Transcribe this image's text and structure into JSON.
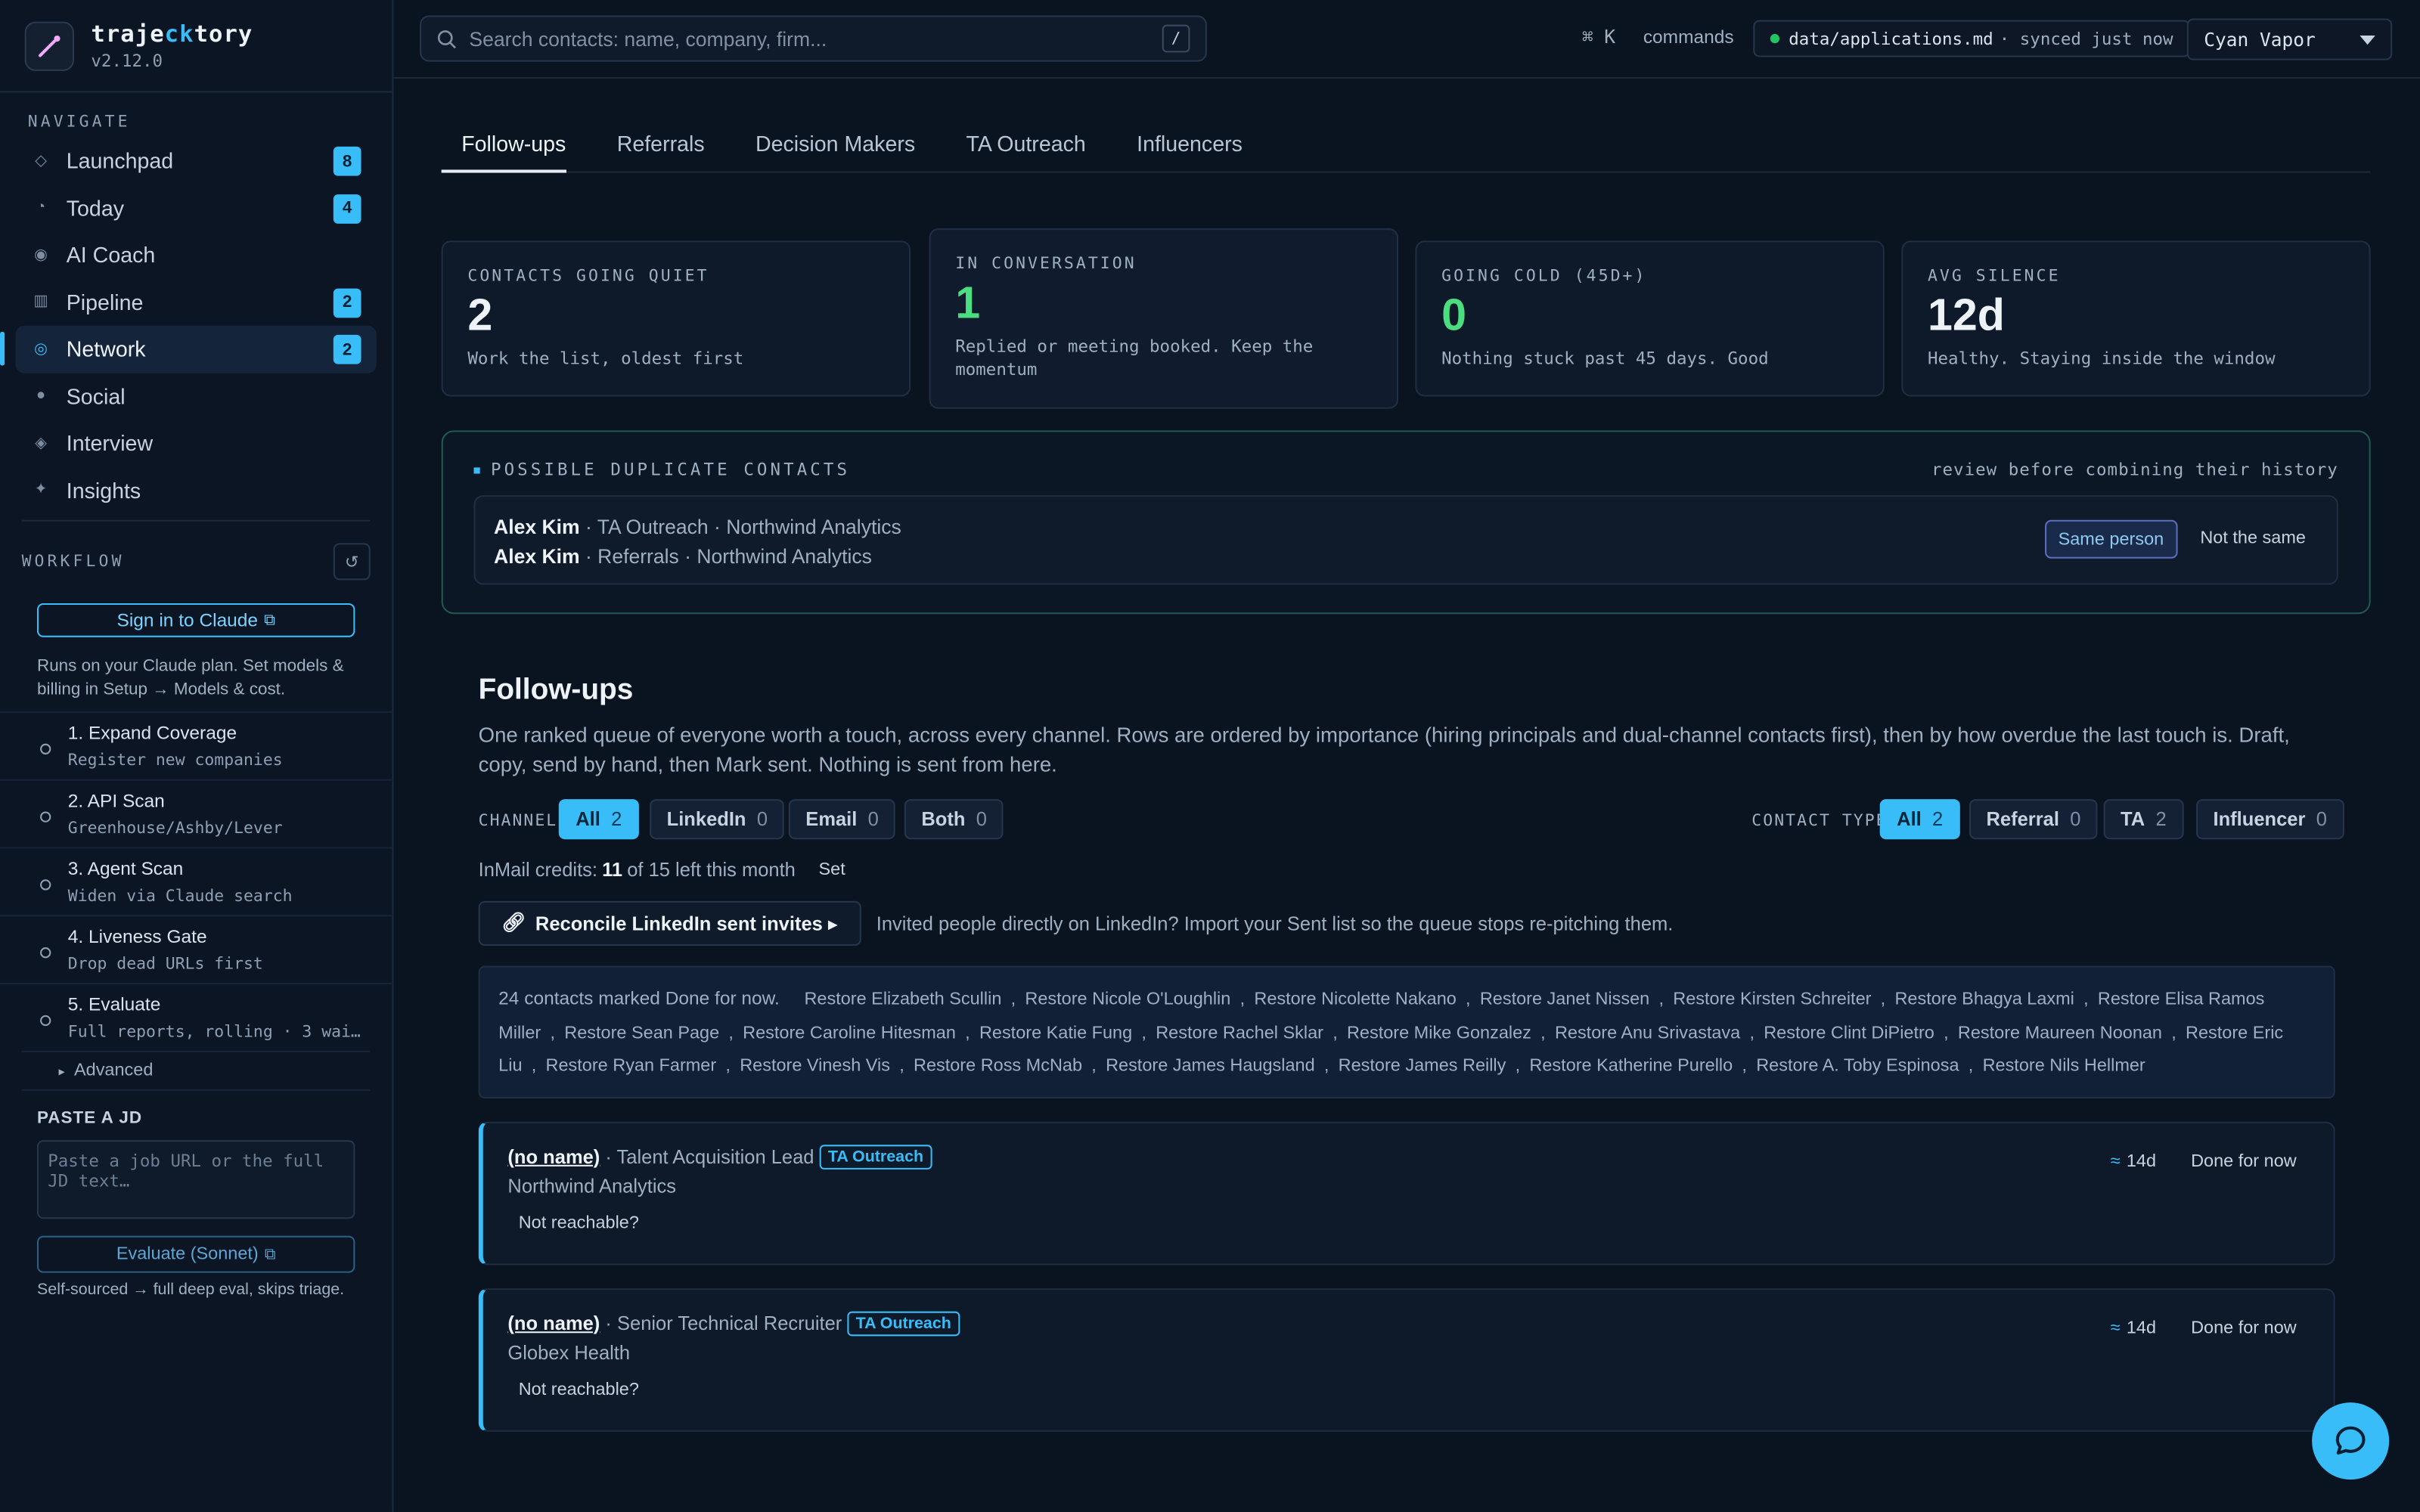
{
  "brand": {
    "name_a": "traje",
    "name_b": "ck",
    "name_c": "tory",
    "version": "v2.12.0"
  },
  "sidebar": {
    "navigate_label": "NAVIGATE",
    "nav": [
      {
        "label": "Launchpad",
        "badge": "8"
      },
      {
        "label": "Today",
        "badge": "4"
      },
      {
        "label": "AI Coach",
        "badge": ""
      },
      {
        "label": "Pipeline",
        "badge": "2"
      },
      {
        "label": "Network",
        "badge": "2"
      },
      {
        "label": "Social",
        "badge": ""
      },
      {
        "label": "Interview",
        "badge": ""
      },
      {
        "label": "Insights",
        "badge": ""
      }
    ],
    "active": "Network",
    "workflow_label": "WORKFLOW",
    "signin_label": "Sign in to Claude",
    "plan_note": "Runs on your Claude plan. Set models & billing in Setup → Models & cost.",
    "steps": [
      {
        "title": "1. Expand Coverage",
        "sub": "Register new companies"
      },
      {
        "title": "2. API Scan",
        "sub": "Greenhouse/Ashby/Lever"
      },
      {
        "title": "3. Agent Scan",
        "sub": "Widen via Claude search"
      },
      {
        "title": "4. Liveness Gate",
        "sub": "Drop dead URLs first"
      },
      {
        "title": "5. Evaluate",
        "sub": "Full reports, rolling · 3 wai…"
      }
    ],
    "advanced_label": "Advanced",
    "jd_label": "PASTE A JD",
    "jd_placeholder": "Paste a job URL or the full JD text…",
    "evaluate_label": "Evaluate (Sonnet)",
    "evaluate_note": "Self-sourced → full deep eval, skips triage."
  },
  "topbar": {
    "search_placeholder": "Search contacts: name, company, firm...",
    "search_key": "/",
    "cmd_key": "⌘ K",
    "cmd_label": "commands",
    "sync_path": "data/applications.md",
    "sync_status": "· synced just now",
    "theme": "Cyan Vapor",
    "colors": {
      "accent": "#38bdf8",
      "success": "#4ade80",
      "bg": "#0a1320"
    }
  },
  "tabs": [
    "Follow-ups",
    "Referrals",
    "Decision Makers",
    "TA Outreach",
    "Influencers"
  ],
  "stats": [
    {
      "label": "CONTACTS GOING QUIET",
      "value": "2",
      "desc": "Work the list, oldest first"
    },
    {
      "label": "IN CONVERSATION",
      "value": "1",
      "desc": "Replied or meeting booked. Keep the momentum"
    },
    {
      "label": "GOING COLD (45D+)",
      "value": "0",
      "desc": "Nothing stuck past 45 days. Good"
    },
    {
      "label": "AVG SILENCE",
      "value": "12d",
      "desc": "Healthy. Staying inside the window"
    }
  ],
  "duplicates": {
    "title": "POSSIBLE DUPLICATE CONTACTS",
    "note": "review before combining their history",
    "a_name": "Alex Kim",
    "a_meta": " · TA Outreach · Northwind Analytics",
    "b_name": "Alex Kim",
    "b_meta": " · Referrals · Northwind Analytics",
    "same": "Same person",
    "not_same": "Not the same"
  },
  "followups": {
    "title": "Follow-ups",
    "intro": "One ranked queue of everyone worth a touch, across every channel. Rows are ordered by importance (hiring principals and dual-channel contacts first), then by how overdue the last touch is. Draft, copy, send by hand, then Mark sent. Nothing is sent from here.",
    "channel_label": "CHANNEL",
    "channels": [
      {
        "label": "All",
        "count": "2"
      },
      {
        "label": "LinkedIn",
        "count": "0"
      },
      {
        "label": "Email",
        "count": "0"
      },
      {
        "label": "Both",
        "count": "0"
      }
    ],
    "type_label": "CONTACT TYPE",
    "types": [
      {
        "label": "All",
        "count": "2"
      },
      {
        "label": "Referral",
        "count": "0"
      },
      {
        "label": "TA",
        "count": "2"
      },
      {
        "label": "Influencer",
        "count": "0"
      }
    ],
    "credits_prefix": "InMail credits:",
    "credits_used": "11",
    "credits_suffix": "of 15 left this month",
    "credits_set": "Set",
    "reconcile_label": "Reconcile LinkedIn sent invites ▸",
    "reconcile_note": "Invited people directly on LinkedIn? Import your Sent list so the queue stops re-pitching them.",
    "done_lead": "24 contacts marked Done for now.",
    "restore": [
      "Restore Elizabeth Scullin",
      "Restore Nicole O'Loughlin",
      "Restore Nicolette Nakano",
      "Restore Janet Nissen",
      "Restore Kirsten Schreiter",
      "Restore Bhagya Laxmi",
      "Restore Elisa Ramos Miller",
      "Restore Sean Page",
      "Restore Caroline Hitesman",
      "Restore Katie Fung",
      "Restore Rachel Sklar",
      "Restore Mike Gonzalez",
      "Restore Anu Srivastava",
      "Restore Clint DiPietro",
      "Restore Maureen Noonan",
      "Restore Eric Liu",
      "Restore Ryan Farmer",
      "Restore Vinesh Vis",
      "Restore Ross McNab",
      "Restore James Haugsland",
      "Restore James Reilly",
      "Restore Katherine Purello",
      "Restore A. Toby Espinosa",
      "Restore Nils Hellmer"
    ],
    "cards": [
      {
        "name": "(no name)",
        "role": " · Talent Acquisition Lead",
        "tag": "TA Outreach",
        "company": "Northwind Analytics",
        "note": "Not reachable?",
        "age": "14d",
        "action": "Done for now"
      },
      {
        "name": "(no name)",
        "role": " · Senior Technical Recruiter",
        "tag": "TA Outreach",
        "company": "Globex Health",
        "note": "Not reachable?",
        "age": "14d",
        "action": "Done for now"
      }
    ]
  }
}
